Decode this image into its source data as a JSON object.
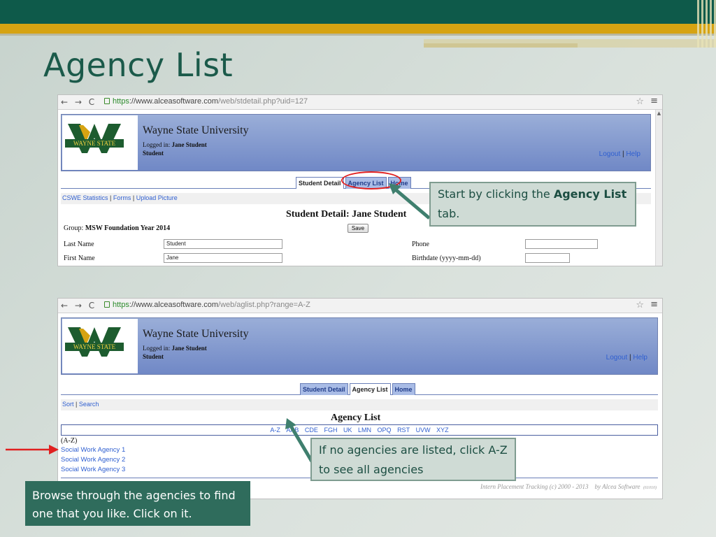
{
  "slide": {
    "title": "Agency List",
    "callout_1": {
      "prefix": "Start by clicking the ",
      "bold": "Agency List",
      "suffix": " tab."
    },
    "callout_2": "If no agencies are listed, click A-Z to see all agencies",
    "callout_3": "Browse through the agencies to find one that you like. Click on it."
  },
  "colors": {
    "accent_dark": "#0e5a4a",
    "gold": "#d6a312",
    "link": "#2f5fd0",
    "highlight": "#e02020"
  },
  "browser_1": {
    "url_scheme": "https",
    "url_host": "://www.alceasoftware.com",
    "url_path": "/web/stdetail.php?uid=127",
    "logo_text": "WAYNE STATE",
    "university": "Wayne State University",
    "logged_in_label": "Logged in:",
    "user_name": "Jane Student",
    "user_role": "Student",
    "logout": "Logout",
    "help": "Help",
    "tabs": {
      "student_detail": "Student Detail",
      "agency_list": "Agency List",
      "home": "Home"
    },
    "subnav": {
      "cswe": "CSWE Statistics",
      "forms": "Forms",
      "upload": "Upload Picture"
    },
    "page_heading": "Student Detail: Jane Student",
    "group_label": "Group:",
    "group_value": "MSW Foundation Year 2014",
    "save": "Save",
    "fields": {
      "last_name_label": "Last Name",
      "last_name_value": "Student",
      "first_name_label": "First Name",
      "first_name_value": "Jane",
      "phone_label": "Phone",
      "phone_value": "",
      "birthdate_label": "Birthdate (yyyy-mm-dd)",
      "birthdate_value": ""
    }
  },
  "browser_2": {
    "url_scheme": "https",
    "url_host": "://www.alceasoftware.com",
    "url_path": "/web/aglist.php?range=A-Z",
    "logo_text": "WAYNE STATE",
    "university": "Wayne State University",
    "logged_in_label": "Logged in:",
    "user_name": "Jane Student",
    "user_role": "Student",
    "logout": "Logout",
    "help": "Help",
    "tabs": {
      "student_detail": "Student Detail",
      "agency_list": "Agency List",
      "home": "Home"
    },
    "subnav": {
      "sort": "Sort",
      "search": "Search"
    },
    "page_heading": "Agency List",
    "alpha_ranges": [
      "A-Z",
      "AAB",
      "CDE",
      "FGH",
      "UK",
      "LMN",
      "OPQ",
      "RST",
      "UVW",
      "XYZ"
    ],
    "range_label": "(A-Z)",
    "agencies": [
      "Social Work Agency 1",
      "Social Work Agency 2",
      "Social Work Agency 3"
    ],
    "footer": "Intern Placement Tracking (c) 2000 - 2013",
    "footer_by": "by Alcea Software",
    "footer_ver": "(61010)"
  }
}
